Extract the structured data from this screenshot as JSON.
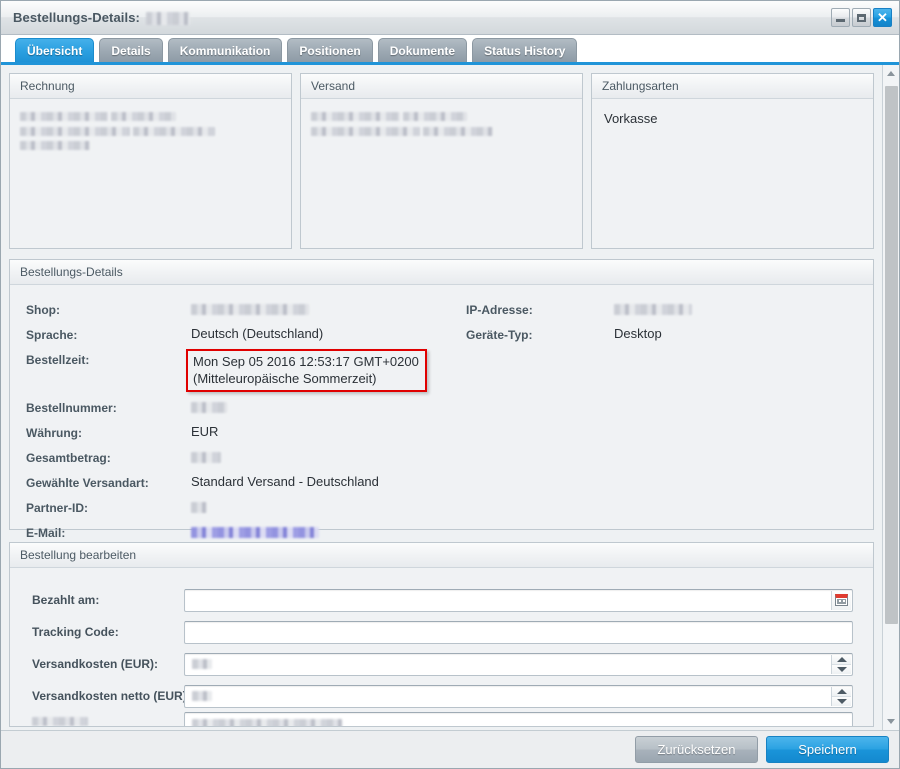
{
  "window": {
    "title_prefix": "Bestellungs-Details:",
    "title_value_redacted": true,
    "controls": {
      "minimize_label": "—",
      "maximize_label": "□",
      "close_label": "✕"
    }
  },
  "tabs": [
    {
      "label": "Übersicht",
      "active": true
    },
    {
      "label": "Details",
      "active": false
    },
    {
      "label": "Kommunikation",
      "active": false
    },
    {
      "label": "Positionen",
      "active": false
    },
    {
      "label": "Dokumente",
      "active": false
    },
    {
      "label": "Status History",
      "active": false
    }
  ],
  "address_panels": [
    {
      "title": "Rechnung",
      "redacted_lines": 5
    },
    {
      "title": "Versand",
      "redacted_lines": 4
    },
    {
      "title": "Zahlungsarten",
      "value": "Vorkasse"
    }
  ],
  "details": {
    "title": "Bestellungs-Details",
    "left_fields": [
      {
        "label": "Shop:",
        "value": "",
        "redacted": true,
        "redact_width": 118
      },
      {
        "label": "Sprache:",
        "value": "Deutsch (Deutschland)",
        "redacted": false
      },
      {
        "label": "Bestellzeit:",
        "value": "Mon Sep 05 2016 12:53:17 GMT+0200",
        "value_line2": "(Mitteleuropäische Sommerzeit)",
        "redacted": false,
        "highlighted": true
      },
      {
        "label": "Bestellnummer:",
        "value": "",
        "redacted": true,
        "redact_width": 36
      },
      {
        "label": "Währung:",
        "value": "EUR",
        "redacted": false
      },
      {
        "label": "Gesamtbetrag:",
        "value": "",
        "redacted": true,
        "redact_width": 30
      },
      {
        "label": "Gewählte Versandart:",
        "value": "Standard Versand - Deutschland",
        "redacted": false
      },
      {
        "label": "Partner-ID:",
        "value": "",
        "redacted": true,
        "redact_width": 16
      },
      {
        "label": "E-Mail:",
        "value": "",
        "redacted": true,
        "redact_width": 128,
        "is_link": true
      }
    ],
    "right_fields": [
      {
        "label": "IP-Adresse:",
        "value": "",
        "redacted": true,
        "redact_width": 78
      },
      {
        "label": "Geräte-Typ:",
        "value": "Desktop",
        "redacted": false
      }
    ]
  },
  "edit_form": {
    "title": "Bestellung bearbeiten",
    "fields": [
      {
        "label": "Bezahlt am:",
        "value": "",
        "placeholder": "",
        "redacted": false,
        "control": "datepicker",
        "icon": "calendar-icon"
      },
      {
        "label": "Tracking Code:",
        "value": "",
        "placeholder": "",
        "redacted": false,
        "control": "text"
      },
      {
        "label": "Versandkosten (EUR):",
        "value": "",
        "redacted": true,
        "redact_width": 20,
        "control": "spinner"
      },
      {
        "label": "Versandkosten netto (EUR):",
        "value": "",
        "redacted": true,
        "redact_width": 20,
        "control": "spinner"
      },
      {
        "label": "",
        "value": "",
        "redacted": true,
        "redact_width": 150,
        "control": "text",
        "clipped": true
      }
    ]
  },
  "toolbar": {
    "reset_label": "Zurücksetzen",
    "save_label": "Speichern"
  },
  "colors": {
    "accent_blue": "#2094d8",
    "highlight_red": "#e00000",
    "panel_bg": "#f0f2f4",
    "label_text": "#4a5862"
  },
  "scrollbar": {
    "up_arrow": "scroll-up-arrow",
    "down_arrow": "scroll-down-arrow",
    "thumb": "scroll-thumb"
  }
}
